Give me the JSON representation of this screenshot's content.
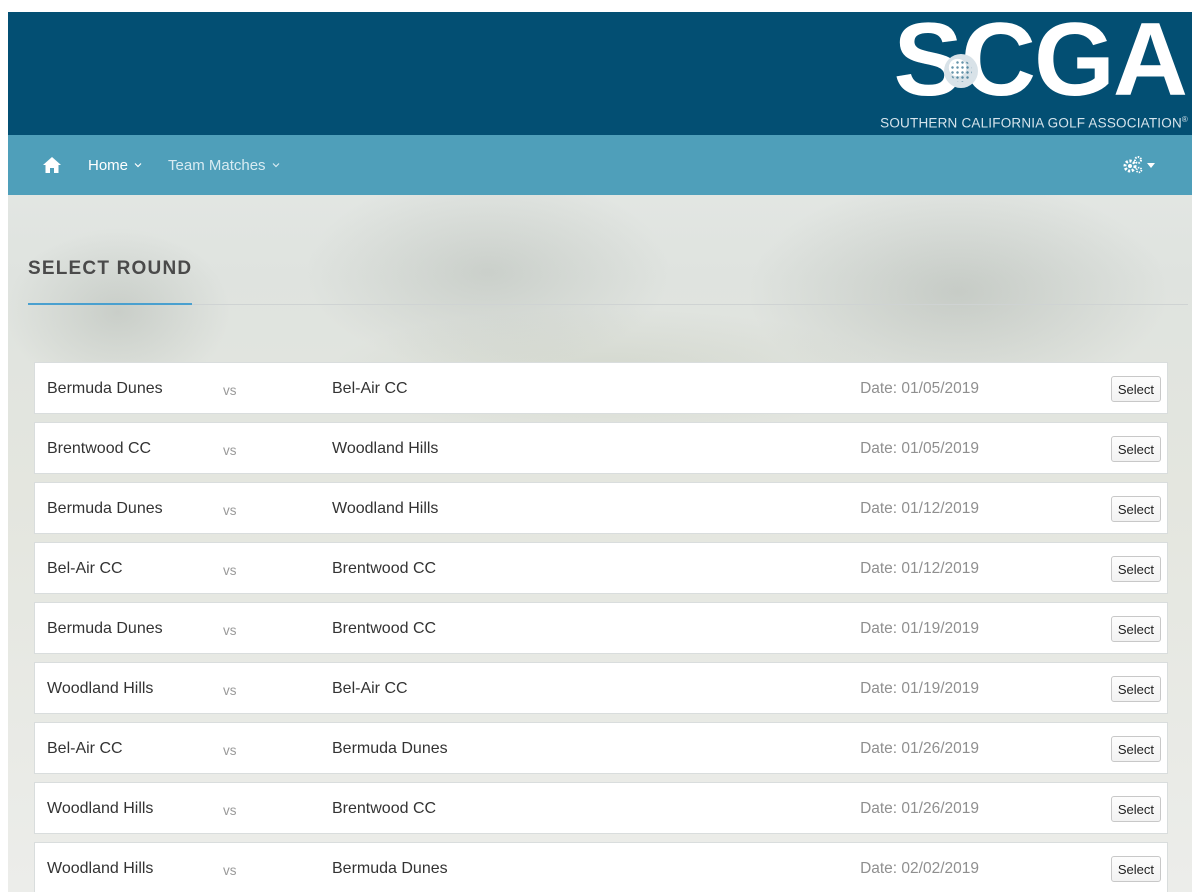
{
  "brand": {
    "logo_letters": "SCGA",
    "logo_subtitle": "SOUTHERN CALIFORNIA GOLF ASSOCIATION",
    "trademark": "®"
  },
  "nav": {
    "home_label": "Home",
    "team_matches_label": "Team Matches",
    "home_icon": "home-icon",
    "settings_icon": "gears-icon"
  },
  "page": {
    "title": "SELECT ROUND"
  },
  "rounds": [
    {
      "team_a": "Bermuda Dunes",
      "vs": "vs",
      "team_b": "Bel-Air CC",
      "date": "Date: 01/05/2019",
      "button": "Select"
    },
    {
      "team_a": "Brentwood CC",
      "vs": "vs",
      "team_b": "Woodland Hills",
      "date": "Date: 01/05/2019",
      "button": "Select"
    },
    {
      "team_a": "Bermuda Dunes",
      "vs": "vs",
      "team_b": "Woodland Hills",
      "date": "Date: 01/12/2019",
      "button": "Select"
    },
    {
      "team_a": "Bel-Air CC",
      "vs": "vs",
      "team_b": "Brentwood CC",
      "date": "Date: 01/12/2019",
      "button": "Select"
    },
    {
      "team_a": "Bermuda Dunes",
      "vs": "vs",
      "team_b": "Brentwood CC",
      "date": "Date: 01/19/2019",
      "button": "Select"
    },
    {
      "team_a": "Woodland Hills",
      "vs": "vs",
      "team_b": "Bel-Air CC",
      "date": "Date: 01/19/2019",
      "button": "Select"
    },
    {
      "team_a": "Bel-Air CC",
      "vs": "vs",
      "team_b": "Bermuda Dunes",
      "date": "Date: 01/26/2019",
      "button": "Select"
    },
    {
      "team_a": "Woodland Hills",
      "vs": "vs",
      "team_b": "Brentwood CC",
      "date": "Date: 01/26/2019",
      "button": "Select"
    },
    {
      "team_a": "Woodland Hills",
      "vs": "vs",
      "team_b": "Bermuda Dunes",
      "date": "Date: 02/02/2019",
      "button": "Select"
    }
  ],
  "colors": {
    "banner": "#034f73",
    "nav": "#4f9fba",
    "accent": "#4aa0cf"
  }
}
